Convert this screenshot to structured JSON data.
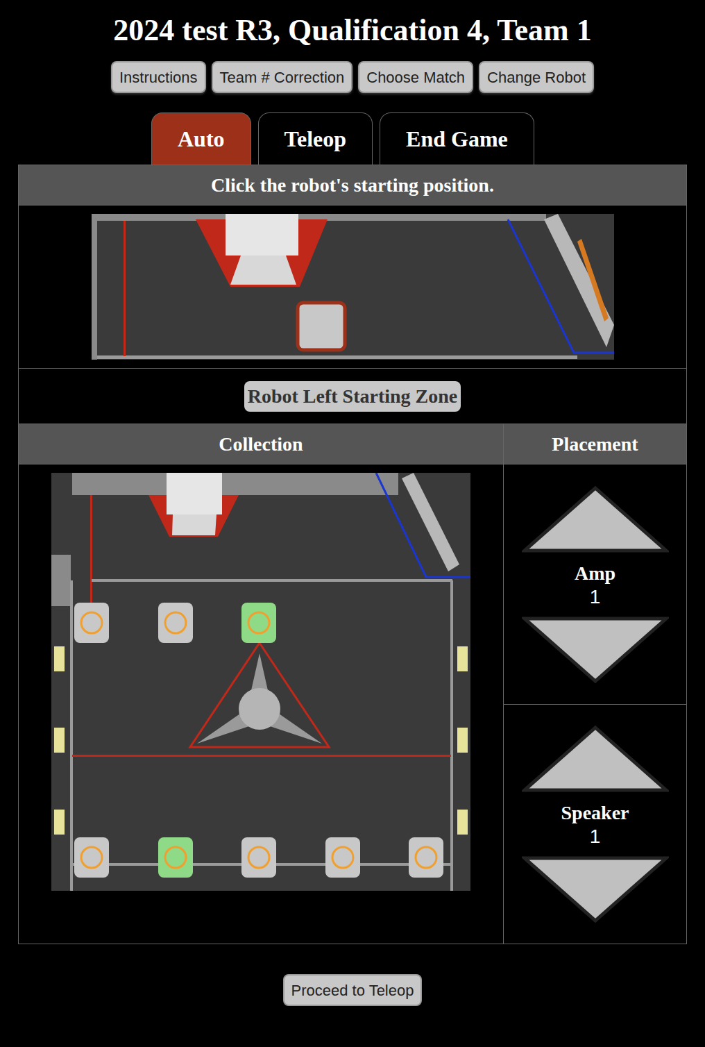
{
  "title": "2024 test R3, Qualification 4, Team 1",
  "nav_buttons": [
    "Instructions",
    "Team # Correction",
    "Choose Match",
    "Change Robot"
  ],
  "tabs": [
    {
      "label": "Auto",
      "selected": true
    },
    {
      "label": "Teleop",
      "selected": false
    },
    {
      "label": "End Game",
      "selected": false
    }
  ],
  "start_section": {
    "header": "Click the robot's starting position.",
    "start_marker_shown": true
  },
  "left_zone_button": {
    "label": "Robot Left Starting Zone",
    "selected": false
  },
  "collection": {
    "header": "Collection",
    "top_notes": [
      {
        "selected": false
      },
      {
        "selected": false
      },
      {
        "selected": true
      }
    ],
    "bottom_notes": [
      {
        "selected": false
      },
      {
        "selected": true
      },
      {
        "selected": false
      },
      {
        "selected": false
      },
      {
        "selected": false
      }
    ]
  },
  "placement": {
    "header": "Placement",
    "counters": [
      {
        "label": "Amp",
        "count": "1"
      },
      {
        "label": "Speaker",
        "count": "1"
      }
    ]
  },
  "proceed_button": "Proceed to Teleop"
}
